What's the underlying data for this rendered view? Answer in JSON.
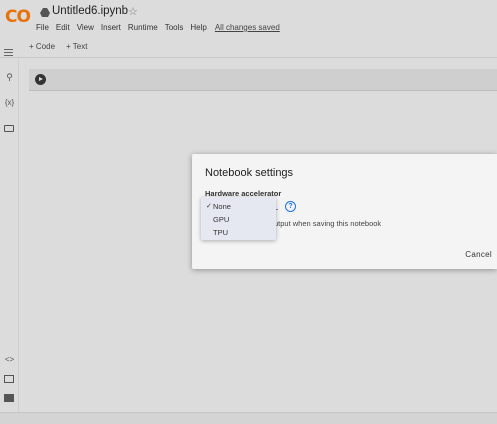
{
  "header": {
    "logo_text": "CO",
    "notebook_title": "Untitled6.ipynb",
    "star_icon": "☆",
    "menu": [
      "File",
      "Edit",
      "View",
      "Insert",
      "Runtime",
      "Tools",
      "Help"
    ],
    "save_status": "All changes saved"
  },
  "toolbar": {
    "add_code": "+ Code",
    "add_text": "+ Text"
  },
  "sidebar": {
    "search_glyph": "⚲",
    "variables_glyph": "{x}",
    "code_snippets_glyph": "<>"
  },
  "dialog": {
    "title": "Notebook settings",
    "field_label": "Hardware accelerator",
    "help_glyph": "?",
    "omit_text": "utput when saving this notebook",
    "cancel_label": "Cancel"
  },
  "dropdown": {
    "options": [
      "None",
      "GPU",
      "TPU"
    ],
    "selected": "None",
    "check_glyph": "✓"
  },
  "colors": {
    "logo": "#e8710a",
    "accent": "#1a73e8",
    "background": "#dcdcdc",
    "dialog": "#f4f4f4",
    "dropdown": "#e6e8f1"
  }
}
